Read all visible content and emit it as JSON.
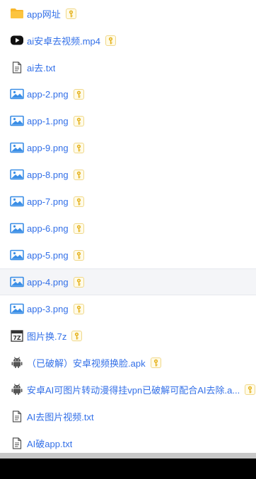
{
  "files": [
    {
      "name": "app网址",
      "icon": "folder-icon",
      "key": true
    },
    {
      "name": "ai安卓去视频.mp4",
      "icon": "video-icon",
      "key": true
    },
    {
      "name": "ai去.txt",
      "icon": "text-file-icon",
      "key": false
    },
    {
      "name": "app-2.png",
      "icon": "image-icon",
      "key": true
    },
    {
      "name": "app-1.png",
      "icon": "image-icon",
      "key": true
    },
    {
      "name": "app-9.png",
      "icon": "image-icon",
      "key": true
    },
    {
      "name": "app-8.png",
      "icon": "image-icon",
      "key": true
    },
    {
      "name": "app-7.png",
      "icon": "image-icon",
      "key": true
    },
    {
      "name": "app-6.png",
      "icon": "image-icon",
      "key": true
    },
    {
      "name": "app-5.png",
      "icon": "image-icon",
      "key": true
    },
    {
      "name": "app-4.png",
      "icon": "image-icon",
      "key": true,
      "highlighted": true
    },
    {
      "name": "app-3.png",
      "icon": "image-icon",
      "key": true
    },
    {
      "name": "图片换.7z",
      "icon": "archive-icon",
      "key": true
    },
    {
      "name": "（已破解）安卓视频换脸.apk",
      "icon": "android-icon",
      "key": true
    },
    {
      "name": "安卓AI可图片转动漫得挂vpn已破解可配合AI去除.a...",
      "icon": "android-icon",
      "key": true
    },
    {
      "name": "AI去图片视频.txt",
      "icon": "text-file-icon",
      "key": false
    },
    {
      "name": "AI破app.txt",
      "icon": "text-file-icon",
      "key": false
    }
  ],
  "colors": {
    "link": "#3370e8",
    "folder": "#f8b62a",
    "image": "#3a8ee6",
    "key_gold": "#e6b422",
    "highlight_row": "#f4f5f8"
  },
  "key_icon": "key-icon"
}
